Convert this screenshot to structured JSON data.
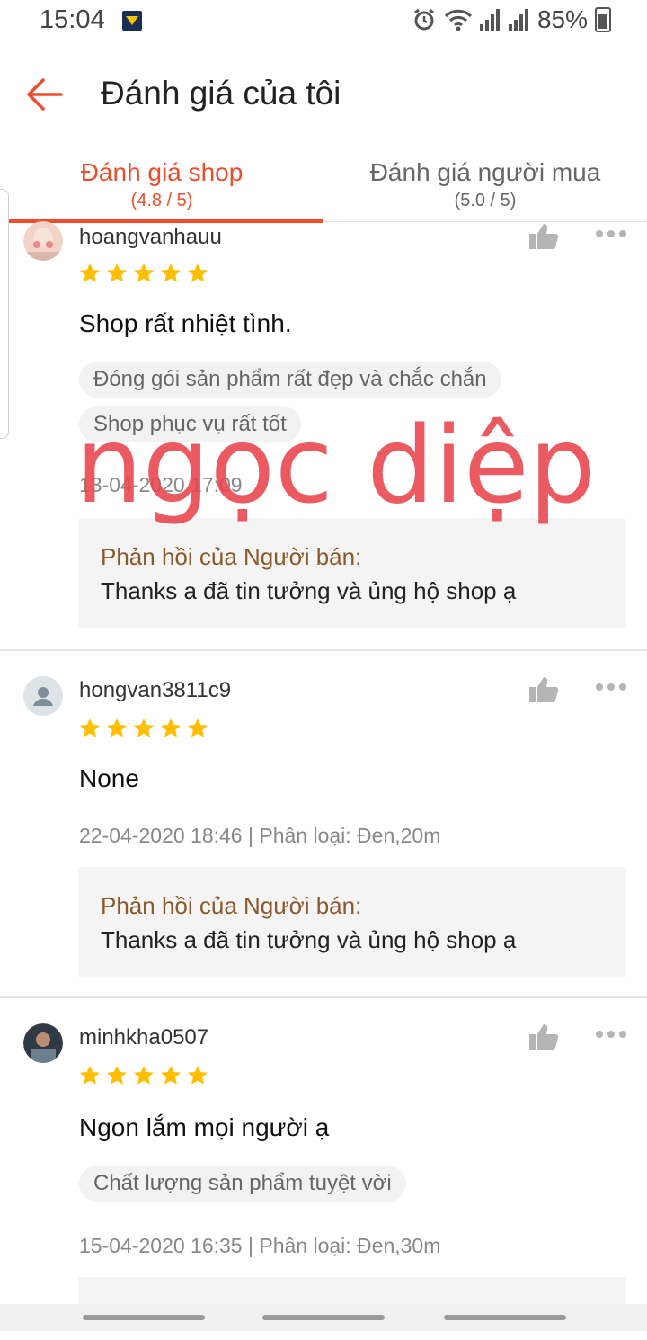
{
  "status_bar": {
    "time": "15:04",
    "battery": "85%"
  },
  "header": {
    "title": "Đánh giá của tôi"
  },
  "tabs": [
    {
      "label": "Đánh giá shop",
      "rating": "(4.8 / 5)",
      "active": true
    },
    {
      "label": "Đánh giá người mua",
      "rating": "(5.0 / 5)",
      "active": false
    }
  ],
  "reviews": [
    {
      "username": "hoangvanhauu",
      "stars": 5,
      "comment": "Shop rất nhiệt tình.",
      "tags": [
        "Đóng gói sản phẩm rất đẹp và chắc chắn",
        "Shop phục vụ rất tốt"
      ],
      "meta": "13-04-2020 17:09",
      "reply_title": "Phản hồi của Người bán:",
      "reply_text": "Thanks a đã tin tưởng và ủng hộ shop ạ"
    },
    {
      "username": "hongvan3811c9",
      "stars": 5,
      "comment": "None",
      "tags": [],
      "meta": "22-04-2020 18:46 | Phân loại: Đen,20m",
      "reply_title": "Phản hồi của Người bán:",
      "reply_text": "Thanks a đã tin tưởng và ủng hộ shop ạ"
    },
    {
      "username": "minhkha0507",
      "stars": 5,
      "comment": "Ngon lắm mọi người ạ",
      "tags": [
        "Chất lượng sản phẩm tuyệt vời"
      ],
      "meta": "15-04-2020 16:35 | Phân loại: Đen,30m",
      "reply_title": "",
      "reply_text": ""
    }
  ],
  "watermark": {
    "text": "ngọc diệp",
    "color": "#e8434b"
  },
  "colors": {
    "accent": "#ee4d2d",
    "star": "#ffbf00",
    "reply_title": "#8a5a2b"
  }
}
